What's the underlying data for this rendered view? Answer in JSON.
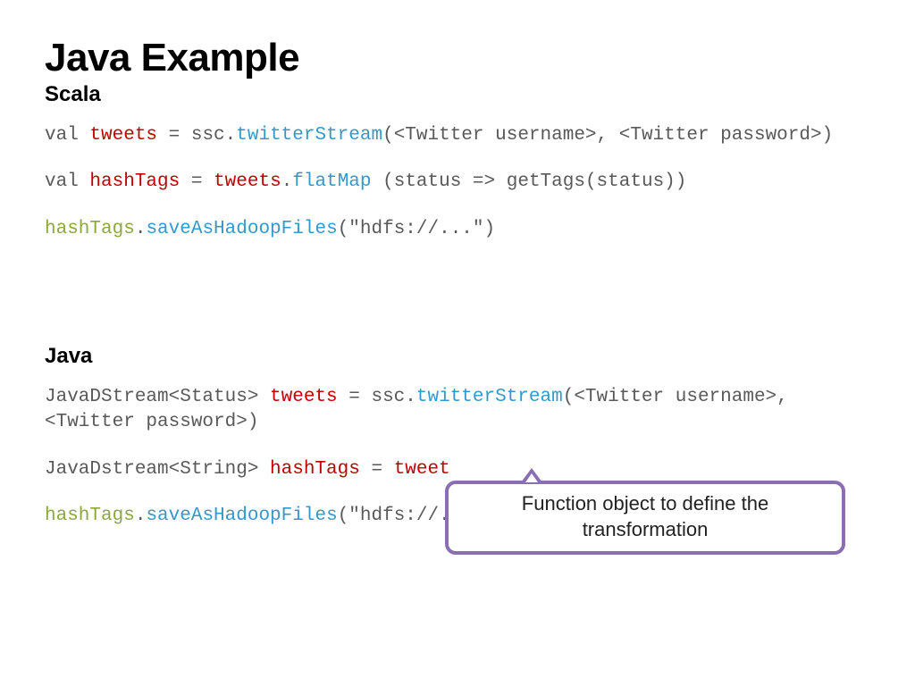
{
  "title": "Java Example",
  "scala": {
    "heading": "Scala",
    "line1": {
      "kw": "val ",
      "var": "tweets",
      "mid": " = ssc.",
      "fn": "twitterStream",
      "rest": "(<Twitter username>, <Twitter password>)"
    },
    "line2": {
      "kw": "val ",
      "var": "hashTags",
      "eq": " = ",
      "src": "tweets",
      "dot": ".",
      "fn": "flatMap",
      "rest": " (status => getTags(status))"
    },
    "line3": {
      "var": "hashTags",
      "dot": ".",
      "fn": "saveAsHadoopFiles",
      "rest": "(\"hdfs://...\")"
    }
  },
  "java": {
    "heading": "Java",
    "line1": {
      "pre": "JavaDStream<Status> ",
      "var": "tweets",
      "mid": " = ssc.",
      "fn": "twitterStream",
      "rest": "(<Twitter username>, <Twitter password>)"
    },
    "line2": {
      "pre": "JavaDstream<String> ",
      "var": "hashTags",
      "eq": " = ",
      "src": "tweet"
    },
    "line3": {
      "var": "hashTags",
      "dot": ".",
      "fn": "saveAsHadoopFiles",
      "rest": "(\"hdfs://...\")"
    }
  },
  "callout": {
    "line1": "Function object to define the",
    "line2": "transformation"
  },
  "colors": {
    "accent_border": "#8a6db3",
    "red": "#c00000",
    "blue": "#3399cc",
    "green": "#8ba83d",
    "gray": "#595959"
  }
}
